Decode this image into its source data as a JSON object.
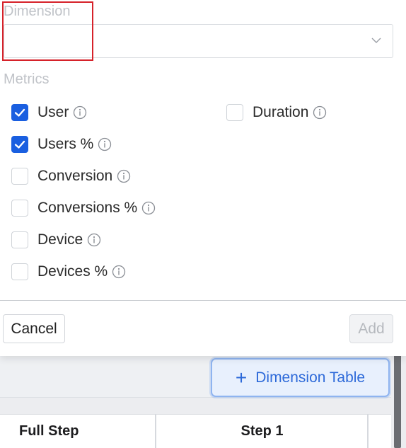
{
  "popup": {
    "dimension_label": "Dimension",
    "dimension_select": {
      "value": "",
      "icon": "chevron-down-icon"
    },
    "metrics_label": "Metrics",
    "metrics": [
      {
        "label": "User",
        "checked": true,
        "icon": "info-icon"
      },
      {
        "label": "Duration",
        "checked": false,
        "icon": "info-icon"
      },
      {
        "label": "Users %",
        "checked": true,
        "icon": "info-icon"
      },
      {
        "label": "Conversion",
        "checked": false,
        "icon": "info-icon"
      },
      {
        "label": "Conversions %",
        "checked": false,
        "icon": "info-icon"
      },
      {
        "label": "Device",
        "checked": false,
        "icon": "info-icon"
      },
      {
        "label": "Devices %",
        "checked": false,
        "icon": "info-icon"
      }
    ],
    "cancel_label": "Cancel",
    "add_label": "Add",
    "add_disabled": true
  },
  "background": {
    "dimension_table_button": {
      "label": "Dimension Table",
      "icon": "plus-icon"
    },
    "table_headers": [
      "Full Step",
      "Step 1"
    ]
  },
  "colors": {
    "accent": "#1a5fe0",
    "highlight_box": "#d6222a",
    "button_blue_text": "#2e6ad9"
  }
}
